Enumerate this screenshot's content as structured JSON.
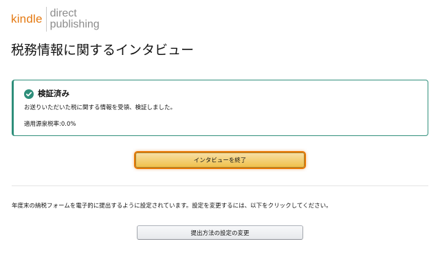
{
  "logo": {
    "kindle": "kindle",
    "direct": "direct",
    "publishing": "publishing"
  },
  "page": {
    "title": "税務情報に関するインタビュー"
  },
  "alert": {
    "title": "検証済み",
    "message": "お送りいただいた税に関する情報を受領、検証しました。",
    "rate": "適用源泉税率:0.0%",
    "icon": "check-circle-icon",
    "accent_color": "#2e8e7a"
  },
  "actions": {
    "end_interview_label": "インタビューを終了",
    "info_text": "年度末の納税フォームを電子的に提出するように設定されています。設定を変更するには、以下をクリックしてください。",
    "change_settings_label": "提出方法の設定の変更"
  },
  "colors": {
    "brand_orange": "#e47911",
    "primary_button": "#f0c14b",
    "focus_ring": "#e77600"
  }
}
